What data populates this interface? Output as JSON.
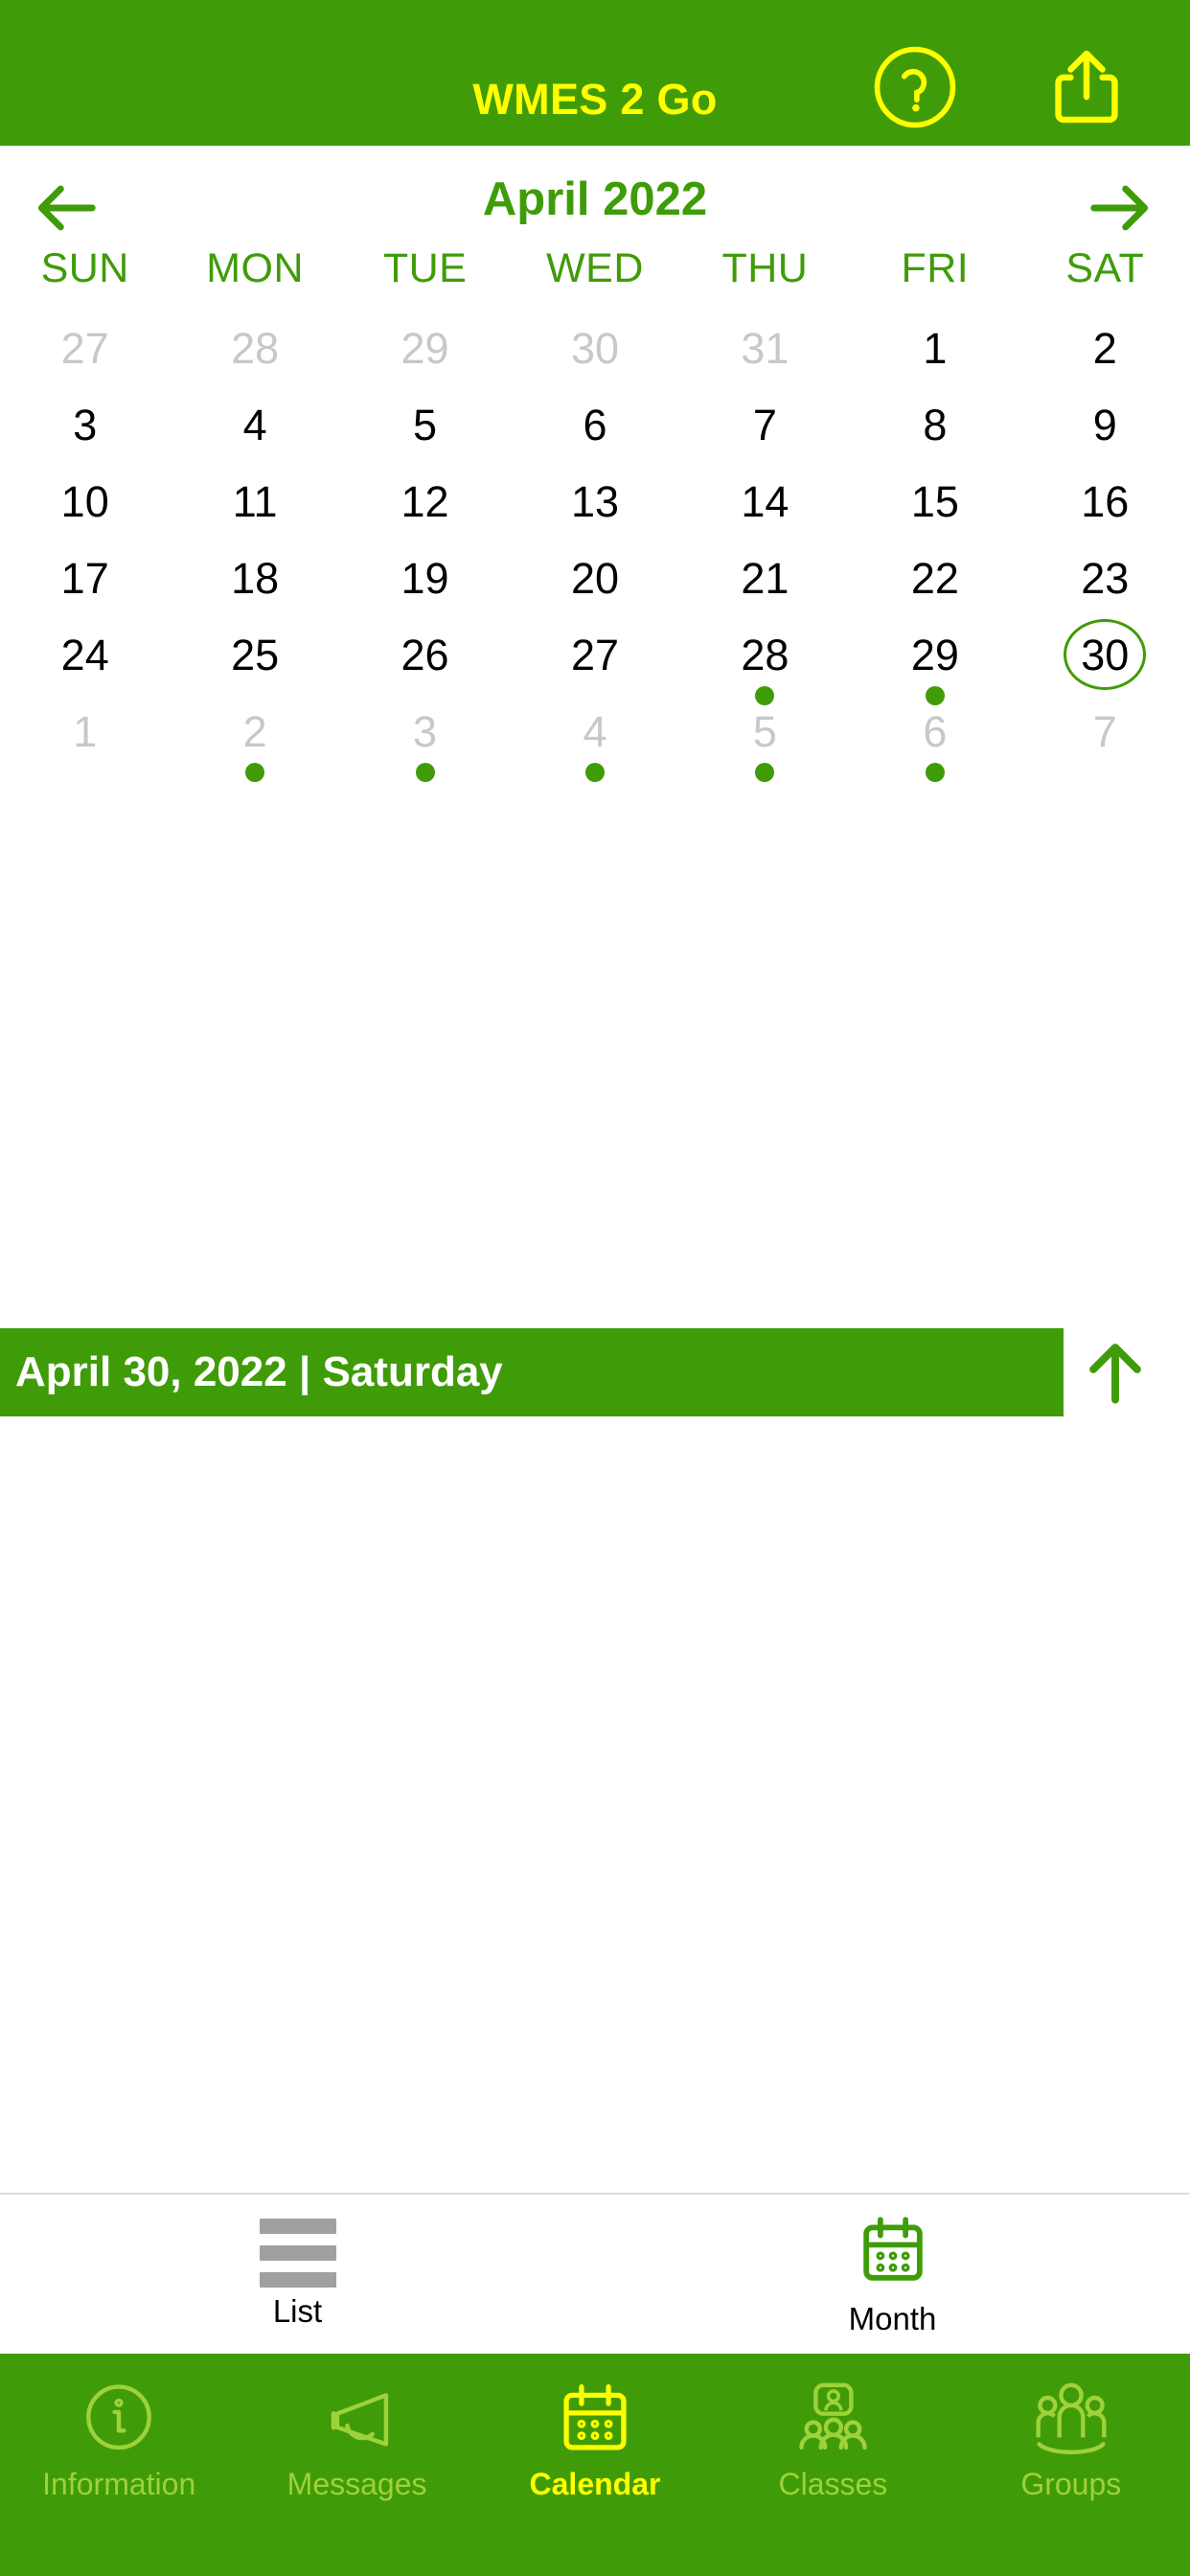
{
  "header": {
    "title": "WMES 2 Go",
    "help_icon": "question-circle-icon",
    "share_icon": "share-icon",
    "bg_color": "#3f9c08",
    "text_color": "#ffff00"
  },
  "calendar": {
    "month_label": "April 2022",
    "prev_icon": "arrow-left-icon",
    "next_icon": "arrow-right-icon",
    "weekdays": [
      "SUN",
      "MON",
      "TUE",
      "WED",
      "THU",
      "FRI",
      "SAT"
    ],
    "accent_color": "#3f9c08",
    "muted_color": "#c8c8c8",
    "weeks": [
      [
        {
          "day": "27",
          "muted": true,
          "dot": false,
          "selected": false
        },
        {
          "day": "28",
          "muted": true,
          "dot": false,
          "selected": false
        },
        {
          "day": "29",
          "muted": true,
          "dot": false,
          "selected": false
        },
        {
          "day": "30",
          "muted": true,
          "dot": false,
          "selected": false
        },
        {
          "day": "31",
          "muted": true,
          "dot": false,
          "selected": false
        },
        {
          "day": "1",
          "muted": false,
          "dot": false,
          "selected": false
        },
        {
          "day": "2",
          "muted": false,
          "dot": false,
          "selected": false
        }
      ],
      [
        {
          "day": "3",
          "muted": false,
          "dot": false,
          "selected": false
        },
        {
          "day": "4",
          "muted": false,
          "dot": false,
          "selected": false
        },
        {
          "day": "5",
          "muted": false,
          "dot": false,
          "selected": false
        },
        {
          "day": "6",
          "muted": false,
          "dot": false,
          "selected": false
        },
        {
          "day": "7",
          "muted": false,
          "dot": false,
          "selected": false
        },
        {
          "day": "8",
          "muted": false,
          "dot": false,
          "selected": false
        },
        {
          "day": "9",
          "muted": false,
          "dot": false,
          "selected": false
        }
      ],
      [
        {
          "day": "10",
          "muted": false,
          "dot": false,
          "selected": false
        },
        {
          "day": "11",
          "muted": false,
          "dot": false,
          "selected": false
        },
        {
          "day": "12",
          "muted": false,
          "dot": false,
          "selected": false
        },
        {
          "day": "13",
          "muted": false,
          "dot": false,
          "selected": false
        },
        {
          "day": "14",
          "muted": false,
          "dot": false,
          "selected": false
        },
        {
          "day": "15",
          "muted": false,
          "dot": false,
          "selected": false
        },
        {
          "day": "16",
          "muted": false,
          "dot": false,
          "selected": false
        }
      ],
      [
        {
          "day": "17",
          "muted": false,
          "dot": false,
          "selected": false
        },
        {
          "day": "18",
          "muted": false,
          "dot": false,
          "selected": false
        },
        {
          "day": "19",
          "muted": false,
          "dot": false,
          "selected": false
        },
        {
          "day": "20",
          "muted": false,
          "dot": false,
          "selected": false
        },
        {
          "day": "21",
          "muted": false,
          "dot": false,
          "selected": false
        },
        {
          "day": "22",
          "muted": false,
          "dot": false,
          "selected": false
        },
        {
          "day": "23",
          "muted": false,
          "dot": false,
          "selected": false
        }
      ],
      [
        {
          "day": "24",
          "muted": false,
          "dot": false,
          "selected": false
        },
        {
          "day": "25",
          "muted": false,
          "dot": false,
          "selected": false
        },
        {
          "day": "26",
          "muted": false,
          "dot": false,
          "selected": false
        },
        {
          "day": "27",
          "muted": false,
          "dot": false,
          "selected": false
        },
        {
          "day": "28",
          "muted": false,
          "dot": true,
          "selected": false
        },
        {
          "day": "29",
          "muted": false,
          "dot": true,
          "selected": false
        },
        {
          "day": "30",
          "muted": false,
          "dot": false,
          "selected": true
        }
      ],
      [
        {
          "day": "1",
          "muted": true,
          "dot": false,
          "selected": false
        },
        {
          "day": "2",
          "muted": true,
          "dot": true,
          "selected": false
        },
        {
          "day": "3",
          "muted": true,
          "dot": true,
          "selected": false
        },
        {
          "day": "4",
          "muted": true,
          "dot": true,
          "selected": false
        },
        {
          "day": "5",
          "muted": true,
          "dot": true,
          "selected": false
        },
        {
          "day": "6",
          "muted": true,
          "dot": true,
          "selected": false
        },
        {
          "day": "7",
          "muted": true,
          "dot": false,
          "selected": false
        }
      ]
    ]
  },
  "selected_date_bar": {
    "text": "April 30, 2022 | Saturday",
    "collapse_icon": "arrow-up-icon",
    "bg_color": "#3f9c08",
    "text_color": "#ffffff"
  },
  "view_toggle": {
    "items": [
      {
        "label": "List",
        "icon": "list-icon",
        "active": false
      },
      {
        "label": "Month",
        "icon": "calendar-icon",
        "active": true
      }
    ]
  },
  "tabbar": {
    "items": [
      {
        "label": "Information",
        "icon": "info-circle-icon",
        "active": false
      },
      {
        "label": "Messages",
        "icon": "megaphone-icon",
        "active": false
      },
      {
        "label": "Calendar",
        "icon": "calendar-icon",
        "active": true
      },
      {
        "label": "Classes",
        "icon": "classroom-icon",
        "active": false
      },
      {
        "label": "Groups",
        "icon": "people-icon",
        "active": false
      }
    ],
    "bg_color": "#3f9c08",
    "active_color": "#ffff00",
    "inactive_color": "#9fd13a"
  }
}
